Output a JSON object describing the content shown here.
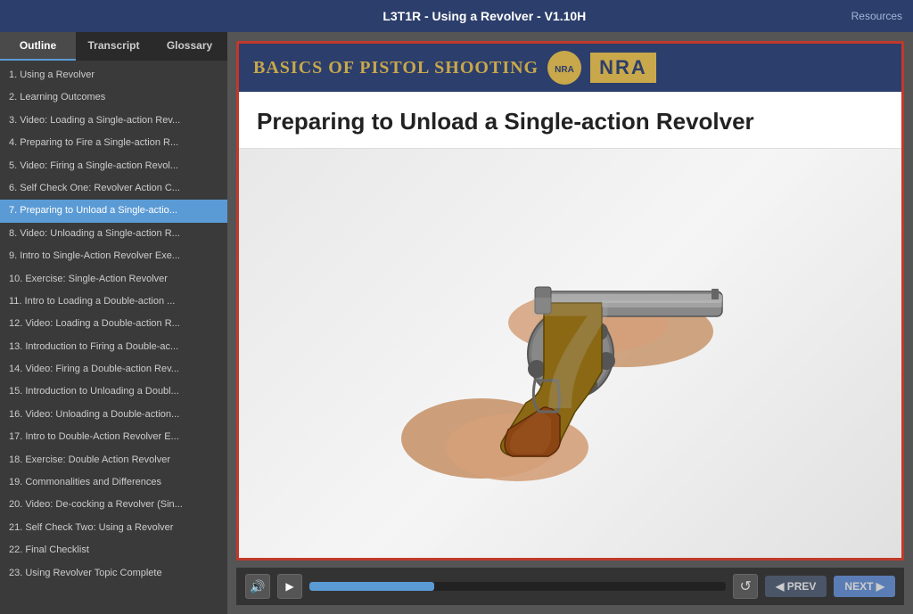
{
  "topBar": {
    "title": "L3T1R - Using a Revolver - V1.10H",
    "resources": "Resources"
  },
  "sidebar": {
    "tabs": [
      {
        "id": "outline",
        "label": "Outline",
        "active": true
      },
      {
        "id": "transcript",
        "label": "Transcript",
        "active": false
      },
      {
        "id": "glossary",
        "label": "Glossary",
        "active": false
      }
    ],
    "items": [
      {
        "number": "1",
        "label": "1. Using a Revolver",
        "active": false
      },
      {
        "number": "2",
        "label": "2. Learning Outcomes",
        "active": false
      },
      {
        "number": "3",
        "label": "3. Video: Loading a Single-action Rev...",
        "active": false
      },
      {
        "number": "4",
        "label": "4. Preparing to Fire a Single-action R...",
        "active": false
      },
      {
        "number": "5",
        "label": "5. Video: Firing a Single-action Revol...",
        "active": false
      },
      {
        "number": "6",
        "label": "6. Self Check One: Revolver Action C...",
        "active": false
      },
      {
        "number": "7",
        "label": "7. Preparing to Unload a Single-actio...",
        "active": true
      },
      {
        "number": "8",
        "label": "8. Video: Unloading a Single-action R...",
        "active": false
      },
      {
        "number": "9",
        "label": "9. Intro to Single-Action Revolver Exe...",
        "active": false
      },
      {
        "number": "10",
        "label": "10. Exercise: Single-Action Revolver",
        "active": false
      },
      {
        "number": "11",
        "label": "11. Intro to Loading a Double-action ...",
        "active": false
      },
      {
        "number": "12",
        "label": "12. Video: Loading a Double-action R...",
        "active": false
      },
      {
        "number": "13",
        "label": "13. Introduction to Firing a Double-ac...",
        "active": false
      },
      {
        "number": "14",
        "label": "14. Video: Firing a Double-action Rev...",
        "active": false
      },
      {
        "number": "15",
        "label": "15. Introduction to Unloading a Doubl...",
        "active": false
      },
      {
        "number": "16",
        "label": "16. Video: Unloading a Double-action...",
        "active": false
      },
      {
        "number": "17",
        "label": "17. Intro to Double-Action Revolver E...",
        "active": false
      },
      {
        "number": "18",
        "label": "18. Exercise: Double Action Revolver",
        "active": false
      },
      {
        "number": "19",
        "label": "19. Commonalities and Differences",
        "active": false
      },
      {
        "number": "20",
        "label": "20. Video: De-cocking a Revolver (Sin...",
        "active": false
      },
      {
        "number": "21",
        "label": "21. Self Check Two: Using a Revolver",
        "active": false
      },
      {
        "number": "22",
        "label": "22. Final Checklist",
        "active": false
      },
      {
        "number": "23",
        "label": "23. Using Revolver Topic Complete",
        "active": false
      }
    ]
  },
  "slide": {
    "headerTitle": "Basics of Pistol Shooting",
    "nraLabel": "NRA",
    "mainTitle": "Preparing to Unload a Single-action Revolver",
    "watermark": "7"
  },
  "controls": {
    "volumeIcon": "🔊",
    "playIcon": "▶",
    "replayIcon": "↺",
    "prevLabel": "◀ PREV",
    "nextLabel": "NEXT ▶"
  }
}
